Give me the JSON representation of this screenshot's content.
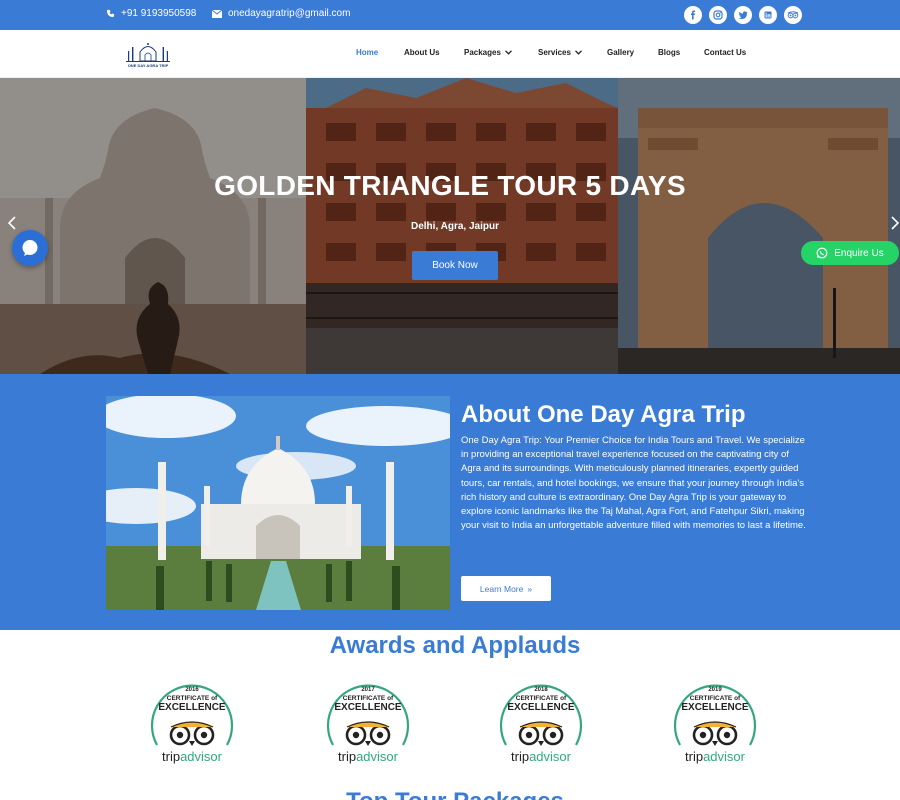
{
  "topbar": {
    "phone": "+91 9193950598",
    "email": "onedayagratrip@gmail.com",
    "social_icons": [
      "facebook-icon",
      "instagram-icon",
      "twitter-icon",
      "linkedin-icon",
      "tripadvisor-icon"
    ]
  },
  "nav": {
    "logo_text": "ONE DAY AGRA TRIP",
    "items": [
      {
        "label": "Home",
        "active": true,
        "dropdown": false
      },
      {
        "label": "About Us",
        "active": false,
        "dropdown": false
      },
      {
        "label": "Packages",
        "active": false,
        "dropdown": true
      },
      {
        "label": "Services",
        "active": false,
        "dropdown": true
      },
      {
        "label": "Gallery",
        "active": false,
        "dropdown": false
      },
      {
        "label": "Blogs",
        "active": false,
        "dropdown": false
      },
      {
        "label": "Contact Us",
        "active": false,
        "dropdown": false
      }
    ]
  },
  "hero": {
    "title": "GOLDEN TRIANGLE TOUR 5 DAYS",
    "subtitle": "Delhi, Agra, Jaipur",
    "button": "Book Now",
    "enquire": "Enquire Us"
  },
  "about": {
    "title": "About One Day Agra Trip",
    "text": "One Day Agra Trip: Your Premier Choice for India Tours and Travel. We specialize in providing an exceptional travel experience focused on the captivating city of Agra and its surroundings. With meticulously planned itineraries, expertly guided tours, car rentals, and hotel bookings, we ensure that your journey through India's rich history and culture is extraordinary. One Day Agra Trip is your gateway to explore iconic landmarks like the Taj Mahal, Agra Fort, and Fatehpur Sikri, making your visit to India an unforgettable adventure filled with memories to last a lifetime.",
    "button": "Learn More",
    "button_icon": "»"
  },
  "awards": {
    "title": "Awards and Applauds",
    "badges": [
      {
        "year": "2016",
        "line1": "CERTIFICATE of",
        "line2": "EXCELLENCE",
        "brand": "tripadvisor"
      },
      {
        "year": "2017",
        "line1": "CERTIFICATE of",
        "line2": "EXCELLENCE",
        "brand": "tripadvisor"
      },
      {
        "year": "2018",
        "line1": "CERTIFICATE of",
        "line2": "EXCELLENCE",
        "brand": "tripadvisor"
      },
      {
        "year": "2019",
        "line1": "CERTIFICATE of",
        "line2": "EXCELLENCE",
        "brand": "tripadvisor"
      }
    ]
  },
  "next_section": {
    "title": "Top Tour Packages"
  },
  "colors": {
    "primary": "#3a7bd5",
    "whatsapp": "#25d366",
    "white": "#ffffff"
  }
}
